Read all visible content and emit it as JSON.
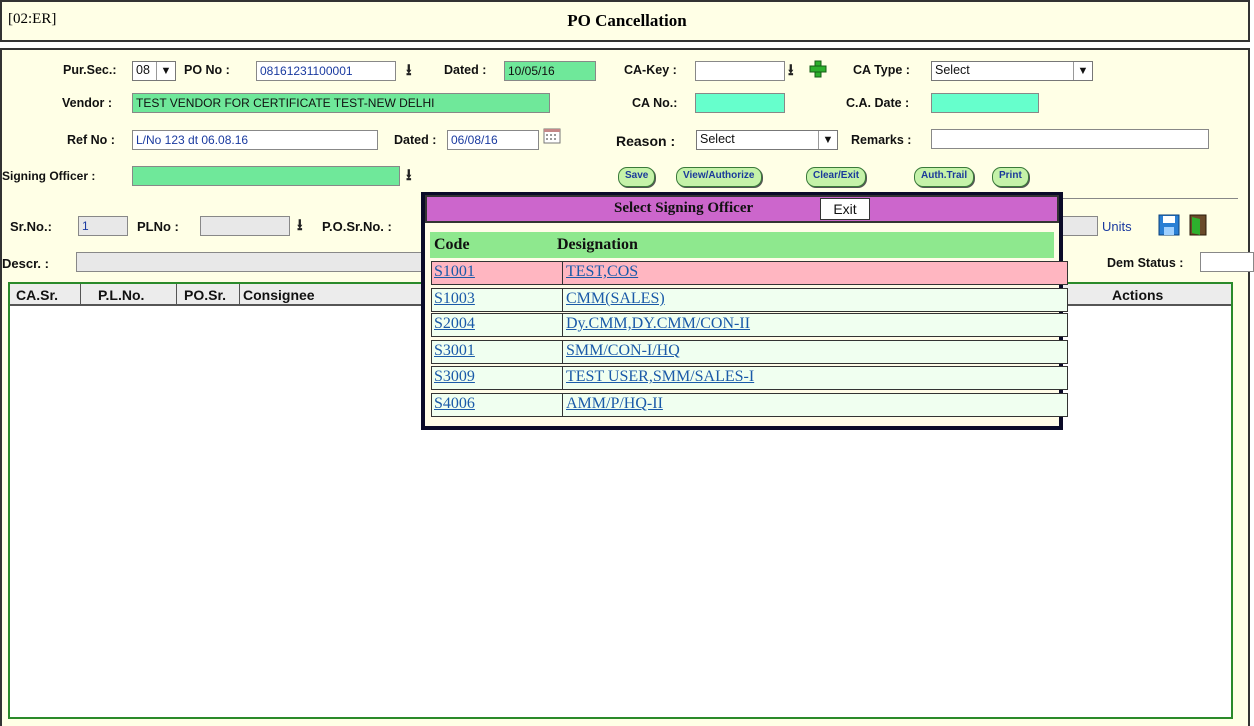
{
  "header": {
    "left": "[02:ER]",
    "title": "PO Cancellation"
  },
  "form": {
    "pur_sec_label": "Pur.Sec.:",
    "pur_sec_value": "08",
    "po_no_label": "PO No :",
    "po_no_value": "08161231100001",
    "dated_label": "Dated :",
    "dated_value": "10/05/16",
    "ca_key_label": "CA-Key :",
    "ca_key_value": "",
    "ca_type_label": "CA Type :",
    "ca_type_value": "Select",
    "vendor_label": "Vendor :",
    "vendor_value": "TEST VENDOR FOR CERTIFICATE TEST-NEW DELHI",
    "ca_no_label": "CA No.:",
    "ca_no_value": "",
    "ca_date_label": "C.A. Date :",
    "ca_date_value": "",
    "ref_no_label": "Ref No :",
    "ref_no_value": "L/No 123 dt 06.08.16",
    "ref_dated_label": "Dated :",
    "ref_dated_value": "06/08/16",
    "reason_label": "Reason :",
    "reason_value": "Select",
    "remarks_label": "Remarks :",
    "remarks_value": "",
    "signing_officer_label": "Signing Officer :",
    "signing_officer_value": "",
    "sr_no_label": "Sr.No.:",
    "sr_no_value": "1",
    "pl_no_label": "PLNo :",
    "pl_no_value": "",
    "po_sr_no_label": "P.O.Sr.No. :",
    "units_label": "Units",
    "descr_label": "Descr. :",
    "dem_status_label": "Dem Status :"
  },
  "buttons": {
    "save": "Save",
    "view": "View/Authorize",
    "clear": "Clear/Exit",
    "auth": "Auth.Trail",
    "print": "Print"
  },
  "grid": {
    "columns": [
      "CA.Sr.",
      "P.L.No.",
      "PO.Sr.",
      "Consignee",
      "Actions"
    ]
  },
  "popup": {
    "title": "Select Signing Officer",
    "exit_label": "Exit",
    "col_code": "Code",
    "col_designation": "Designation",
    "rows": [
      {
        "code": "S1001",
        "designation": "TEST,COS"
      },
      {
        "code": "S1003",
        "designation": "CMM(SALES)"
      },
      {
        "code": "S2004",
        "designation": "Dy.CMM,DY.CMM/CON-II"
      },
      {
        "code": "S3001",
        "designation": "SMM/CON-I/HQ"
      },
      {
        "code": "S3009",
        "designation": "TEST USER,SMM/SALES-I"
      },
      {
        "code": "S4006",
        "designation": "AMM/P/HQ-II"
      }
    ]
  }
}
